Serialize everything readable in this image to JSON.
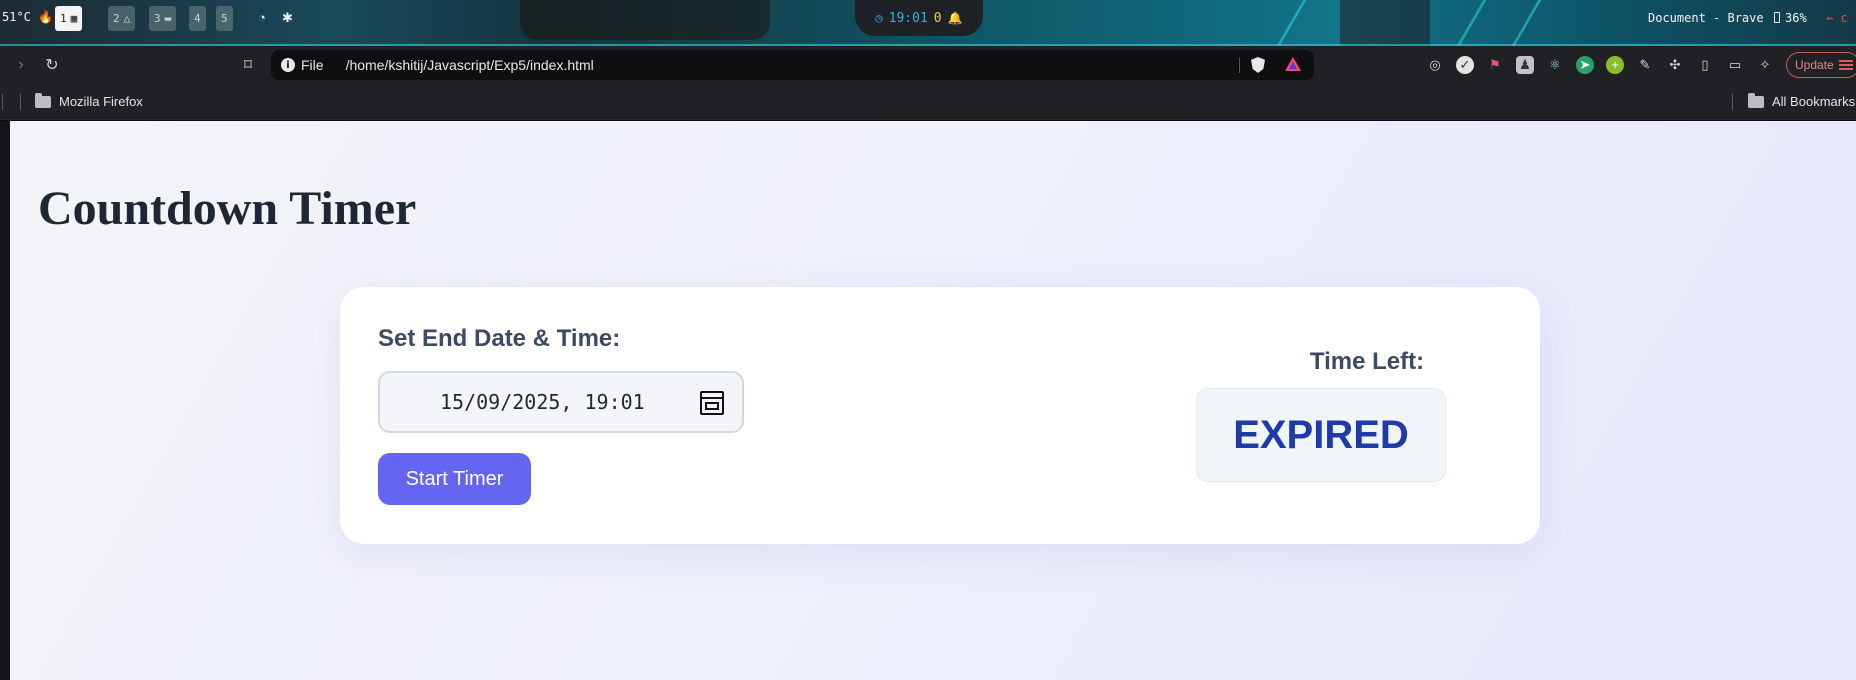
{
  "system_bar": {
    "temperature": "51°C",
    "workspaces": [
      {
        "num": "1",
        "glyph": "▦",
        "active": true
      },
      {
        "num": "2",
        "glyph": "△",
        "active": false
      },
      {
        "num": "3",
        "glyph": "▬",
        "active": false
      },
      {
        "num": "4",
        "glyph": "",
        "active": false
      },
      {
        "num": "5",
        "glyph": "",
        "active": false
      }
    ],
    "clock": "19:01",
    "notification_count": "0",
    "window_title": "Document - Brave",
    "battery": "36%",
    "extra": "c"
  },
  "browser": {
    "url_scheme": "File",
    "url_path": "/home/kshitij/Javascript/Exp5/index.html",
    "update_label": "Update",
    "bookmarks": {
      "items": [
        "Mozilla Firefox"
      ],
      "all_bookmarks": "All Bookmarks"
    }
  },
  "page": {
    "title": "Countdown Timer",
    "end_label": "Set End Date & Time:",
    "datetime_value": "15/09/2025, 19:01",
    "start_button": "Start Timer",
    "time_left_label": "Time Left:",
    "time_left_value": "EXPIRED"
  },
  "colors": {
    "accent_button": "#6466f1",
    "expired_text": "#1e3aa8",
    "heading": "#1e2733"
  }
}
